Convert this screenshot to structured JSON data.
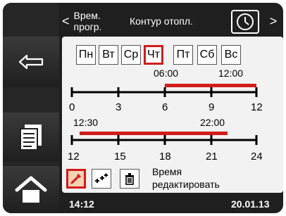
{
  "header": {
    "back_arrow": "<",
    "prev_label": "Врем. прогр.",
    "current_label": "Контур отопл.",
    "next_arrow": ">"
  },
  "days": [
    "Пн",
    "Вт",
    "Ср",
    "Чт",
    "Пт",
    "Сб",
    "Вс"
  ],
  "selected_day": "Чт",
  "timeline_top": {
    "period_start": "06:00",
    "period_end": "12:00",
    "ticks": [
      "0",
      "3",
      "6",
      "9",
      "12"
    ]
  },
  "timeline_bottom": {
    "period_start": "12:30",
    "period_end": "22:00",
    "ticks": [
      "12",
      "15",
      "18",
      "21",
      "24"
    ]
  },
  "edit": {
    "text_line1": "Время",
    "text_line2": "редактировать"
  },
  "status": {
    "time": "14:12",
    "date": "20.01.13"
  },
  "colors": {
    "accent": "#d11c1c",
    "bezel": "#1f1f1f",
    "panel": "#f2f2f2"
  },
  "icons": {
    "clock": "clock-icon",
    "back": "back-arrow-icon",
    "menu": "document-icon",
    "home": "home-icon",
    "edit": "pen-icon",
    "add": "plus-icon",
    "delete": "trash-icon"
  }
}
